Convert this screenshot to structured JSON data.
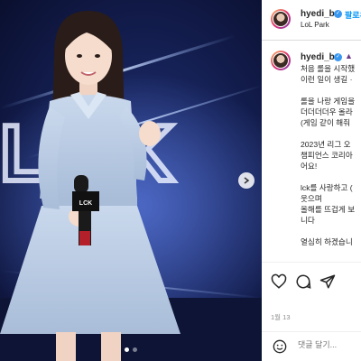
{
  "header": {
    "username": "hyedi_b",
    "follow_label": "팔로우",
    "location": "LoL Park"
  },
  "caption": {
    "username": "hyedi_b",
    "lines": [
      "처음 롤을 시작했",
      "이런 일이 생길 ·",
      "",
      "롤을 나랑 게임을",
      "더더더더우 올라",
      "(게임 같이 해줘",
      "",
      "2023년 리그 오",
      "챔피언스 코리아",
      "어요!",
      "",
      "lck를 사랑하고 (",
      "웃으며",
      "올해를 뜨겁게 보",
      "니다",
      "",
      "열심히 하겠습니"
    ]
  },
  "actions": {
    "like_icon": "heart-icon",
    "comment_icon": "comment-icon",
    "share_icon": "share-icon"
  },
  "date": "1월 13",
  "comment": {
    "placeholder": "댓글 달기..."
  },
  "media": {
    "backdrop_text": "LCK",
    "mic_logo": "LCK"
  },
  "colors": {
    "accent": "#0095f6",
    "verified": "#3897f0",
    "dress": "#b9cbe3"
  }
}
